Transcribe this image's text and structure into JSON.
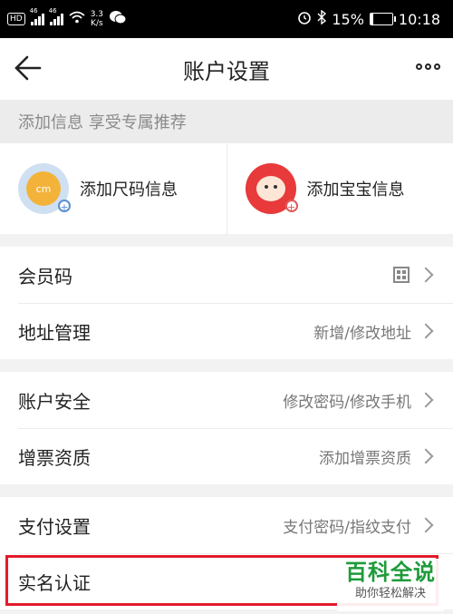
{
  "status_bar": {
    "hd_badge": "HD",
    "sig1_label": "46",
    "sig2_label": "46",
    "speed_value": "3.3",
    "speed_unit": "K/s",
    "battery_percent": "15%",
    "battery_level": 0.15,
    "time": "10:18"
  },
  "nav": {
    "title": "账户设置"
  },
  "tip": "添加信息 享受专属推荐",
  "cards": [
    {
      "label": "添加尺码信息",
      "icon_text": "cm"
    },
    {
      "label": "添加宝宝信息"
    }
  ],
  "groups": [
    [
      {
        "label": "会员码",
        "value": ""
      },
      {
        "label": "地址管理",
        "value": "新增/修改地址"
      }
    ],
    [
      {
        "label": "账户安全",
        "value": "修改密码/修改手机"
      },
      {
        "label": "增票资质",
        "value": "添加增票资质"
      }
    ],
    [
      {
        "label": "支付设置",
        "value": "支付密码/指纹支付"
      },
      {
        "label": "实名认证",
        "value": ""
      }
    ]
  ],
  "watermark": {
    "brand": "百科全说",
    "slogan": "助你轻松解决"
  },
  "colors": {
    "highlight": "#e21b2b",
    "watermark_green": "#1e9b3a"
  }
}
